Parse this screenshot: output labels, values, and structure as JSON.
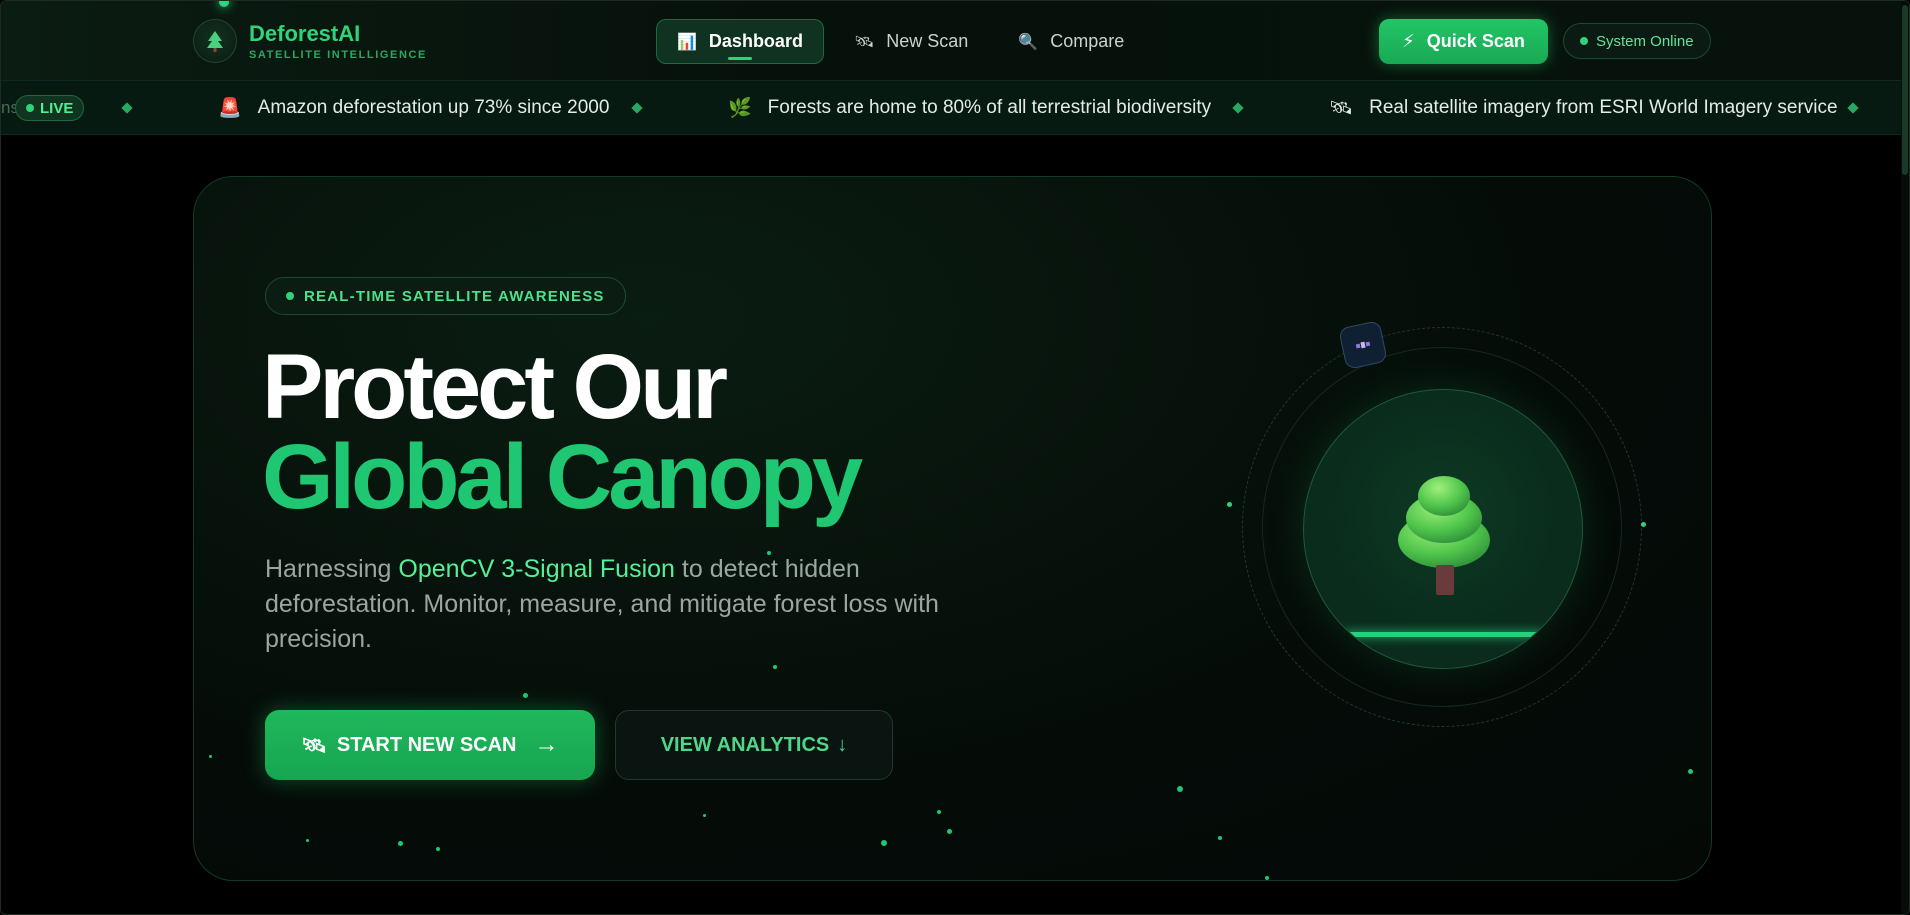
{
  "brand": {
    "title": "DeforestAI",
    "subtitle": "SATELLITE INTELLIGENCE",
    "logo_icon": "tree-icon"
  },
  "nav": {
    "tabs": [
      {
        "label": "Dashboard",
        "icon": "chart-icon",
        "glyph": "📊",
        "active": true
      },
      {
        "label": "New Scan",
        "icon": "satellite-icon",
        "glyph": "🛰",
        "active": false
      },
      {
        "label": "Compare",
        "icon": "magnifier-icon",
        "glyph": "🔍",
        "active": false
      }
    ],
    "quick_scan": {
      "label": "Quick Scan",
      "icon": "lightning-icon",
      "glyph": "⚡"
    },
    "status": {
      "label": "System Online"
    }
  },
  "ticker": {
    "fade_text": "ns",
    "live_label": "LIVE",
    "items": [
      {
        "text": "Amazon deforestation up 73% since 2000",
        "icon": "siren-icon",
        "glyph": "🚨"
      },
      {
        "text": "Forests are home to 80% of all terrestrial biodiversity",
        "icon": "leaf-icon",
        "glyph": "🌿"
      },
      {
        "text": "Real satellite imagery from ESRI World Imagery service",
        "icon": "satellite-icon",
        "glyph": "🛰"
      }
    ]
  },
  "hero": {
    "badge": "REAL-TIME SATELLITE AWARENESS",
    "headline_line1": "Protect Our",
    "headline_line2": "Global Canopy",
    "sub_prefix": "Harnessing ",
    "sub_highlight": "OpenCV 3-Signal Fusion",
    "sub_suffix": " to detect hidden deforestation. Monitor, measure, and mitigate forest loss with precision.",
    "primary_button": {
      "label": "START NEW SCAN",
      "icon": "satellite-icon",
      "glyph": "🛰",
      "arrow": "→"
    },
    "secondary_button": {
      "label": "VIEW ANALYTICS",
      "arrow": "↓"
    }
  },
  "colors": {
    "accent": "#1fc773",
    "accent_bright": "#2fd479",
    "background": "#000000",
    "card": "#050c08"
  }
}
